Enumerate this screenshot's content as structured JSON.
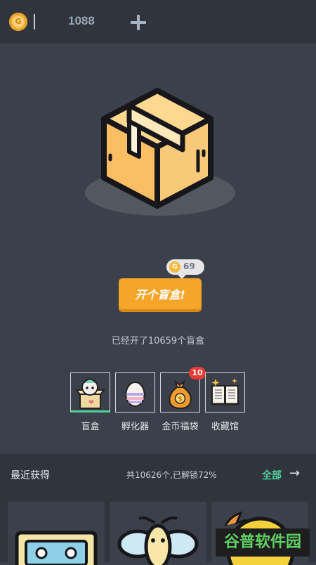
{
  "topbar": {
    "coin_symbol": "G",
    "coin_count": "1088",
    "add_icon": "plus-icon"
  },
  "blind_box": {
    "icon": "cardboard-box-icon",
    "price_symbol": "G",
    "price": "69",
    "open_button_label": "开个盲盒!",
    "opened_text": "已经开了10659个盲盒"
  },
  "tabs": [
    {
      "label": "盲盒",
      "icon": "blind-box-character-icon",
      "active": true
    },
    {
      "label": "孵化器",
      "icon": "egg-icon"
    },
    {
      "label": "金币福袋",
      "icon": "money-bag-icon",
      "badge": "10"
    },
    {
      "label": "收藏馆",
      "icon": "open-book-icon"
    }
  ],
  "recent": {
    "title": "最近获得",
    "stat": "共10626个,已解锁72%",
    "all_label": "全部",
    "arrow": "→"
  },
  "cards": [
    {
      "icon": "cassette-tape-icon"
    },
    {
      "icon": "bee-icon"
    },
    {
      "icon": "lemon-icon"
    }
  ],
  "watermark": "谷普软件园",
  "colors": {
    "background": "#3b404a",
    "bar": "#30343d",
    "accent_orange": "#f5a52a",
    "accent_green": "#4fd09a",
    "badge_red": "#e53b36",
    "coin_gold": "#f4b93d"
  }
}
